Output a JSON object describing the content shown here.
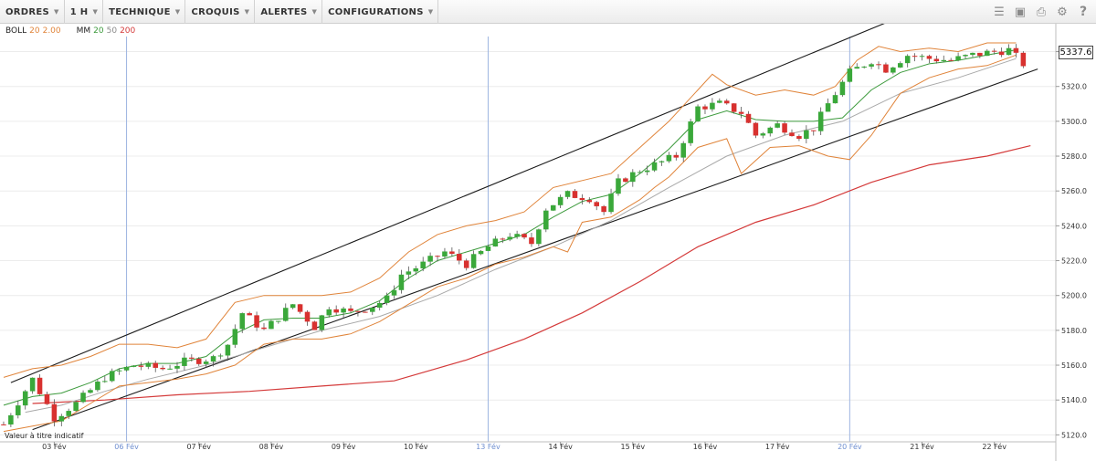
{
  "toolbar": {
    "menus": [
      {
        "label": "ORDRES"
      },
      {
        "label": "1 H"
      },
      {
        "label": "TECHNIQUE"
      },
      {
        "label": "CROQUIS"
      },
      {
        "label": "ALERTES"
      },
      {
        "label": "CONFIGURATIONS"
      }
    ],
    "tool_icons": [
      "layers-icon",
      "image-icon",
      "print-icon",
      "gear-icon",
      "help-icon"
    ]
  },
  "legend": {
    "boll": {
      "name": "BOLL",
      "p1": "20",
      "p2": "2.00"
    },
    "mm": {
      "name": "MM",
      "p1": "20",
      "p2": "50",
      "p3": "200"
    }
  },
  "colors": {
    "up": "#3aa83a",
    "down": "#d8312f",
    "boll": "#e0843a",
    "ma20": "#3c9a3c",
    "ma50": "#a9a9a9",
    "ma200": "#d43a3a",
    "channel": "#1a1a1a",
    "session": "#9db4e0"
  },
  "current_price": "5337.6",
  "note": "Valeur à titre indicatif",
  "chart_data": {
    "type": "candlestick",
    "interval": "1 H",
    "ylim": [
      5116,
      5356
    ],
    "y_ticks": [
      "5120.0",
      "5140.0",
      "5160.0",
      "5180.0",
      "5200.0",
      "5220.0",
      "5240.0",
      "5260.0",
      "5280.0",
      "5300.0",
      "5320.0",
      "5340.0"
    ],
    "x_tick_labels": [
      {
        "label": "03 Fév",
        "pos": 7,
        "session": false
      },
      {
        "label": "06 Fév",
        "pos": 17,
        "session": true
      },
      {
        "label": "07 Fév",
        "pos": 27,
        "session": false
      },
      {
        "label": "08 Fév",
        "pos": 37,
        "session": false
      },
      {
        "label": "09 Fév",
        "pos": 47,
        "session": false
      },
      {
        "label": "10 Fév",
        "pos": 57,
        "session": false
      },
      {
        "label": "13 Fév",
        "pos": 67,
        "session": true
      },
      {
        "label": "14 Fév",
        "pos": 77,
        "session": false
      },
      {
        "label": "15 Fév",
        "pos": 87,
        "session": false
      },
      {
        "label": "16 Fév",
        "pos": 97,
        "session": false
      },
      {
        "label": "17 Fév",
        "pos": 107,
        "session": false
      },
      {
        "label": "20 Fév",
        "pos": 117,
        "session": true
      },
      {
        "label": "21 Fév",
        "pos": 127,
        "session": false
      },
      {
        "label": "22 Fév",
        "pos": 137,
        "session": false
      }
    ],
    "close_path": [
      [
        0,
        5126
      ],
      [
        4,
        5152
      ],
      [
        7,
        5130
      ],
      [
        10,
        5138
      ],
      [
        14,
        5153
      ],
      [
        18,
        5160
      ],
      [
        22,
        5158
      ],
      [
        25,
        5162
      ],
      [
        29,
        5164
      ],
      [
        31,
        5172
      ],
      [
        33,
        5190
      ],
      [
        36,
        5180
      ],
      [
        40,
        5195
      ],
      [
        43,
        5182
      ],
      [
        45,
        5194
      ],
      [
        48,
        5190
      ],
      [
        51,
        5194
      ],
      [
        53,
        5198
      ],
      [
        55,
        5212
      ],
      [
        58,
        5218
      ],
      [
        61,
        5225
      ],
      [
        64,
        5218
      ],
      [
        67,
        5228
      ],
      [
        70,
        5235
      ],
      [
        73,
        5230
      ],
      [
        75,
        5250
      ],
      [
        78,
        5258
      ],
      [
        81,
        5256
      ],
      [
        83,
        5248
      ],
      [
        85,
        5265
      ],
      [
        88,
        5272
      ],
      [
        90,
        5275
      ],
      [
        93,
        5280
      ],
      [
        96,
        5308
      ],
      [
        99,
        5310
      ],
      [
        102,
        5305
      ],
      [
        104,
        5292
      ],
      [
        107,
        5298
      ],
      [
        110,
        5292
      ],
      [
        112,
        5296
      ],
      [
        114,
        5310
      ],
      [
        117,
        5328
      ],
      [
        120,
        5335
      ],
      [
        122,
        5330
      ],
      [
        125,
        5338
      ],
      [
        128,
        5336
      ],
      [
        131,
        5335
      ],
      [
        134,
        5338
      ],
      [
        137,
        5340
      ],
      [
        139,
        5341
      ],
      [
        141,
        5333
      ]
    ],
    "boll_up_path": [
      [
        0,
        5153
      ],
      [
        4,
        5158
      ],
      [
        8,
        5160
      ],
      [
        12,
        5165
      ],
      [
        16,
        5172
      ],
      [
        20,
        5172
      ],
      [
        24,
        5170
      ],
      [
        28,
        5175
      ],
      [
        32,
        5196
      ],
      [
        36,
        5200
      ],
      [
        40,
        5200
      ],
      [
        44,
        5200
      ],
      [
        48,
        5202
      ],
      [
        52,
        5210
      ],
      [
        56,
        5225
      ],
      [
        60,
        5235
      ],
      [
        64,
        5240
      ],
      [
        68,
        5243
      ],
      [
        72,
        5248
      ],
      [
        76,
        5262
      ],
      [
        80,
        5266
      ],
      [
        84,
        5270
      ],
      [
        88,
        5285
      ],
      [
        92,
        5300
      ],
      [
        96,
        5318
      ],
      [
        98,
        5327
      ],
      [
        100,
        5321
      ],
      [
        104,
        5315
      ],
      [
        108,
        5318
      ],
      [
        112,
        5315
      ],
      [
        115,
        5320
      ],
      [
        118,
        5335
      ],
      [
        121,
        5343
      ],
      [
        124,
        5340
      ],
      [
        128,
        5342
      ],
      [
        132,
        5340
      ],
      [
        136,
        5345
      ],
      [
        140,
        5345
      ]
    ],
    "boll_low_path": [
      [
        0,
        5122
      ],
      [
        4,
        5125
      ],
      [
        8,
        5128
      ],
      [
        12,
        5138
      ],
      [
        16,
        5148
      ],
      [
        20,
        5150
      ],
      [
        24,
        5152
      ],
      [
        28,
        5155
      ],
      [
        32,
        5160
      ],
      [
        36,
        5172
      ],
      [
        40,
        5175
      ],
      [
        44,
        5175
      ],
      [
        48,
        5178
      ],
      [
        52,
        5185
      ],
      [
        56,
        5195
      ],
      [
        60,
        5205
      ],
      [
        64,
        5210
      ],
      [
        68,
        5218
      ],
      [
        72,
        5222
      ],
      [
        76,
        5228
      ],
      [
        78,
        5225
      ],
      [
        80,
        5242
      ],
      [
        84,
        5245
      ],
      [
        88,
        5255
      ],
      [
        90,
        5262
      ],
      [
        92,
        5268
      ],
      [
        96,
        5285
      ],
      [
        100,
        5290
      ],
      [
        102,
        5270
      ],
      [
        106,
        5285
      ],
      [
        110,
        5286
      ],
      [
        114,
        5280
      ],
      [
        117,
        5278
      ],
      [
        120,
        5292
      ],
      [
        124,
        5316
      ],
      [
        128,
        5325
      ],
      [
        132,
        5330
      ],
      [
        136,
        5332
      ],
      [
        140,
        5338
      ]
    ],
    "ma20_path": [
      [
        0,
        5137
      ],
      [
        4,
        5142
      ],
      [
        8,
        5144
      ],
      [
        12,
        5150
      ],
      [
        16,
        5158
      ],
      [
        20,
        5161
      ],
      [
        24,
        5161
      ],
      [
        28,
        5165
      ],
      [
        32,
        5178
      ],
      [
        36,
        5186
      ],
      [
        40,
        5187
      ],
      [
        44,
        5187
      ],
      [
        48,
        5190
      ],
      [
        52,
        5197
      ],
      [
        56,
        5210
      ],
      [
        60,
        5220
      ],
      [
        64,
        5225
      ],
      [
        68,
        5230
      ],
      [
        72,
        5235
      ],
      [
        76,
        5245
      ],
      [
        80,
        5254
      ],
      [
        84,
        5258
      ],
      [
        88,
        5270
      ],
      [
        92,
        5284
      ],
      [
        96,
        5301
      ],
      [
        100,
        5306
      ],
      [
        104,
        5301
      ],
      [
        108,
        5300
      ],
      [
        112,
        5300
      ],
      [
        116,
        5302
      ],
      [
        120,
        5318
      ],
      [
        124,
        5328
      ],
      [
        128,
        5333
      ],
      [
        132,
        5335
      ],
      [
        136,
        5338
      ],
      [
        140,
        5341
      ]
    ],
    "ma50_path": [
      [
        3,
        5133
      ],
      [
        8,
        5137
      ],
      [
        14,
        5145
      ],
      [
        20,
        5152
      ],
      [
        28,
        5160
      ],
      [
        36,
        5170
      ],
      [
        44,
        5180
      ],
      [
        52,
        5188
      ],
      [
        60,
        5200
      ],
      [
        68,
        5215
      ],
      [
        76,
        5228
      ],
      [
        84,
        5243
      ],
      [
        92,
        5262
      ],
      [
        100,
        5280
      ],
      [
        108,
        5292
      ],
      [
        116,
        5300
      ],
      [
        124,
        5316
      ],
      [
        132,
        5325
      ],
      [
        140,
        5336
      ]
    ],
    "ma200_path": [
      [
        4,
        5138
      ],
      [
        14,
        5140
      ],
      [
        24,
        5143
      ],
      [
        34,
        5145
      ],
      [
        44,
        5148
      ],
      [
        54,
        5151
      ],
      [
        64,
        5163
      ],
      [
        72,
        5175
      ],
      [
        80,
        5190
      ],
      [
        88,
        5208
      ],
      [
        96,
        5228
      ],
      [
        104,
        5242
      ],
      [
        112,
        5252
      ],
      [
        120,
        5265
      ],
      [
        128,
        5275
      ],
      [
        136,
        5280
      ],
      [
        142,
        5286
      ]
    ],
    "channel_upper": [
      [
        1,
        5150
      ],
      [
        124,
        5360
      ]
    ],
    "channel_lower": [
      [
        4,
        5123
      ],
      [
        143,
        5330
      ]
    ]
  }
}
